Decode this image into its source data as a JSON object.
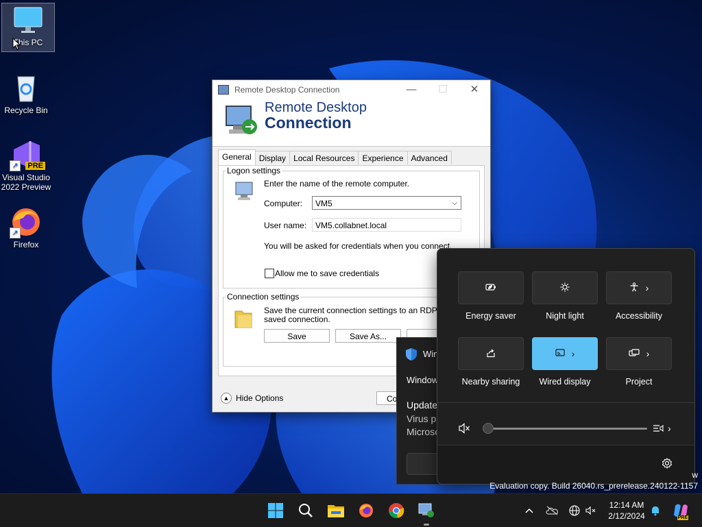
{
  "desktop": {
    "icons": [
      {
        "label": "This PC"
      },
      {
        "label": "Recycle Bin"
      },
      {
        "label": "Visual Studio 2022 Preview",
        "badge": "PRE"
      },
      {
        "label": "Firefox"
      }
    ]
  },
  "rdp": {
    "window_title": "Remote Desktop Connection",
    "banner_line1": "Remote Desktop",
    "banner_line2": "Connection",
    "tabs": [
      "General",
      "Display",
      "Local Resources",
      "Experience",
      "Advanced"
    ],
    "logon": {
      "group_label": "Logon settings",
      "instruction": "Enter the name of the remote computer.",
      "computer_label": "Computer:",
      "computer_value": "VM5",
      "username_label": "User name:",
      "username_value": "VM5.collabnet.local",
      "credentials_note": "You will be asked for credentials when you connect.",
      "save_credentials_label": "Allow me to save credentials"
    },
    "connection": {
      "group_label": "Connection settings",
      "description_line1": "Save the current connection settings to an RDP file or",
      "description_line2": "saved connection.",
      "save_label": "Save",
      "save_as_label": "Save As...",
      "open_label": "O"
    },
    "hide_options_label": "Hide Options",
    "connect_label": "Co"
  },
  "notification": {
    "app_title": "Win",
    "header": "Window",
    "heading": "Update",
    "line1": "Virus pr",
    "line2": "Microso"
  },
  "quick_settings": {
    "tiles": [
      {
        "label": "Energy saver",
        "active": false,
        "chevron": false
      },
      {
        "label": "Night light",
        "active": false,
        "chevron": false
      },
      {
        "label": "Accessibility",
        "active": false,
        "chevron": true
      },
      {
        "label": "Nearby sharing",
        "active": false,
        "chevron": false
      },
      {
        "label": "Wired display",
        "active": true,
        "chevron": true
      },
      {
        "label": "Project",
        "active": false,
        "chevron": true
      }
    ],
    "volume": {
      "muted": true,
      "level": 0
    },
    "accent_color": "#5ec1f5"
  },
  "watermark": {
    "line1": "w",
    "line2": "Evaluation copy. Build 26040.rs_prerelease.240122-1157"
  },
  "taskbar": {
    "apps": [
      "start-icon",
      "search-icon",
      "file-explorer-icon",
      "firefox-icon",
      "chrome-icon",
      "remote-desktop-icon"
    ],
    "time": "12:14 AM",
    "date": "2/12/2024",
    "copilot_badge": "PRE"
  }
}
